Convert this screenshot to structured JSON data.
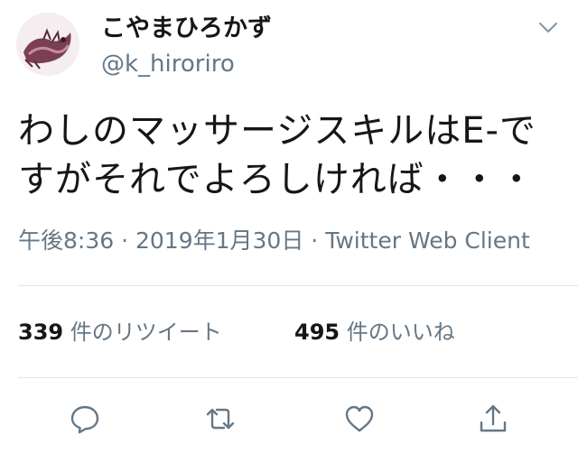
{
  "user": {
    "display_name": "こやまひろかず",
    "handle": "@k_hiroriro"
  },
  "tweet": {
    "text_line_1": "わしのマッサージスキルはE-で",
    "text_line_2": "すがそれでよろしければ・・・"
  },
  "meta": {
    "time": "午後8:36",
    "separator": "·",
    "date": "2019年1月30日",
    "source": "Twitter Web Client"
  },
  "stats": {
    "retweets_count": "339",
    "retweets_label": "件のリツイート",
    "likes_count": "495",
    "likes_label": "件のいいね"
  },
  "icons": {
    "caret": "chevron-down-icon",
    "reply": "reply-icon",
    "retweet": "retweet-icon",
    "like": "heart-icon",
    "share": "share-icon"
  },
  "colors": {
    "text": "#14171a",
    "secondary": "#657786",
    "divider": "#dfe3e8"
  }
}
